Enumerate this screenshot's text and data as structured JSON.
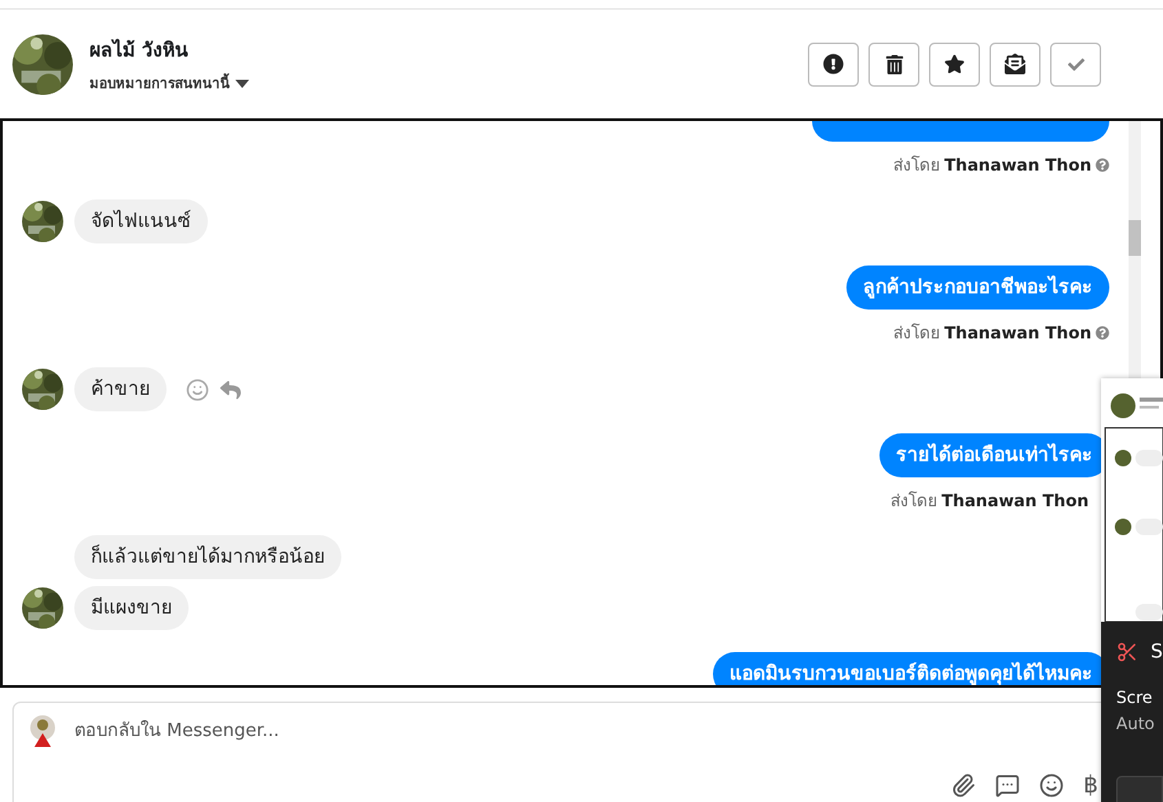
{
  "contact": {
    "name": "ผลไม้ วังหิน",
    "subtitle": "มอบหมายการสนทนานี้"
  },
  "messages": [
    {
      "kind": "outgoing_cut",
      "sender_prefix": "ส่งโดย",
      "sender": "Thanawan Thon",
      "help_icon": true
    },
    {
      "kind": "incoming",
      "text": "จัดไฟแนนซ์",
      "avatar": true,
      "reactions": false
    },
    {
      "kind": "outgoing",
      "text": "ลูกค้าประกอบอาชีพอะไรคะ",
      "sender_prefix": "ส่งโดย",
      "sender": "Thanawan Thon",
      "help_icon": true
    },
    {
      "kind": "incoming",
      "text": "ค้าขาย",
      "avatar": true,
      "reactions": true
    },
    {
      "kind": "outgoing",
      "text": "รายได้ต่อเดือนเท่าไรคะ",
      "sender_prefix": "ส่งโดย",
      "sender": "Thanawan Thon"
    },
    {
      "kind": "incoming",
      "text": "ก็แล้วแต่ขายได้มากหรือน้อย",
      "avatar": false,
      "reactions": false
    },
    {
      "kind": "incoming",
      "text": "มีแผงขาย",
      "avatar": true,
      "reactions": false,
      "grouped": true
    },
    {
      "kind": "outgoing",
      "text": "แอดมินรบกวนขอเบอร์ติดต่อพูดคุยได้ไหมคะ"
    }
  ],
  "composer": {
    "placeholder": "ตอบกลับใน Messenger...",
    "currency": "฿"
  },
  "notification": {
    "title": "S",
    "lines": [
      "Scre",
      "Auto"
    ]
  }
}
